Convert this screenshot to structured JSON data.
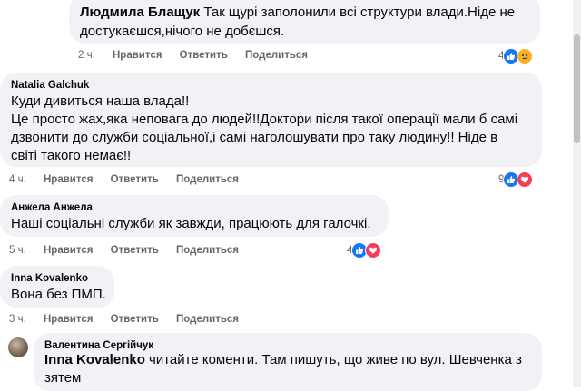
{
  "comments": [
    {
      "author": "Людмила Блащук",
      "text_line1": "Так щурі заполонили всі структури влади.Ніде не",
      "text_line2": "достукаєшся,нічого не добєшся.",
      "time": "2 ч.",
      "like": "Нравится",
      "reply": "Ответить",
      "share": "Поделиться",
      "reaction_count": "4",
      "reactions": [
        "like-icon",
        "sad-icon"
      ]
    },
    {
      "author": "Natalia Galchuk",
      "lines": [
        "Куди дивиться наша влада!!",
        "Це просто жах,яка неповага до людей!!Доктори після такої операції мали б самі",
        "дзвонити до служби соціальної,і самі наголошувати про таку людину!! Ніде в",
        "світі такого немає!!"
      ],
      "time": "4 ч.",
      "like": "Нравится",
      "reply": "Ответить",
      "share": "Поделиться",
      "reaction_count": "9",
      "reactions": [
        "like-icon",
        "love-icon"
      ]
    },
    {
      "author": "Анжела Анжела",
      "text": "Наші соціальні служби як завжди, працюють для галочкі.",
      "time": "5 ч.",
      "like": "Нравится",
      "reply": "Ответить",
      "share": "Поделиться",
      "reaction_count": "4",
      "reactions": [
        "like-icon",
        "love-icon"
      ]
    },
    {
      "author": "Inna Kovalenko",
      "text": "Вона без ПМП.",
      "time": "3 ч.",
      "like": "Нравится",
      "reply": "Ответить",
      "share": "Поделиться"
    }
  ],
  "reply": {
    "author": "Валентина Сергійчук",
    "mention": "Inna Kovalenko",
    "text_after_mention": "читайте коменти. Там пишуть, що живе по вул. Шевченка з",
    "text_line2": "зятем"
  },
  "colors": {
    "bubble_bg": "#f0f2f5",
    "meta_text": "#65676b",
    "like_blue": "#1877f2",
    "love_red": "#f33e58",
    "sad_yellow": "#f7b125"
  }
}
